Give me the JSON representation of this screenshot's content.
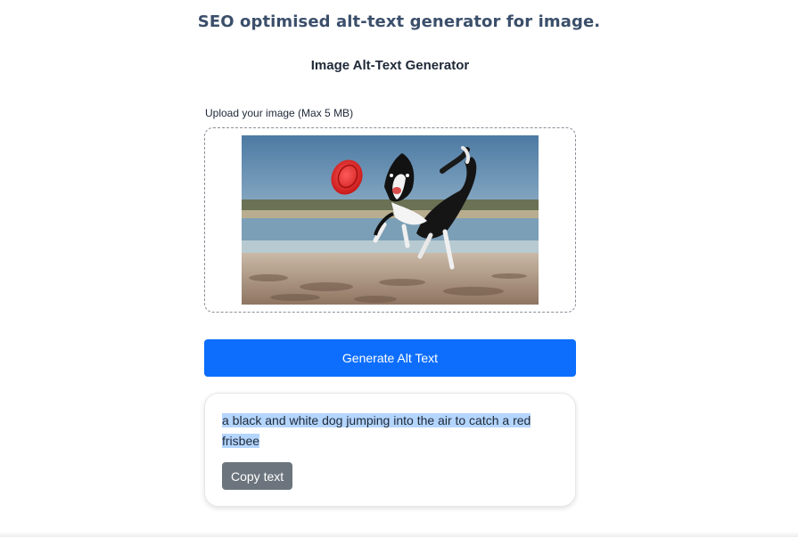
{
  "header": {
    "headline": "SEO optimised alt-text generator for image."
  },
  "app": {
    "title": "Image Alt-Text Generator"
  },
  "upload": {
    "label": "Upload your image (Max 5 MB)",
    "preview_icon": "uploaded-image-preview"
  },
  "actions": {
    "generate_label": "Generate Alt Text",
    "copy_label": "Copy text"
  },
  "result": {
    "alt_text": "a black and white dog jumping into the air to catch a red frisbee",
    "selected": true
  },
  "colors": {
    "primary": "#0d6efd",
    "secondary": "#6c757d",
    "selection": "#b4d5fe",
    "headline": "#3b4f6b"
  }
}
